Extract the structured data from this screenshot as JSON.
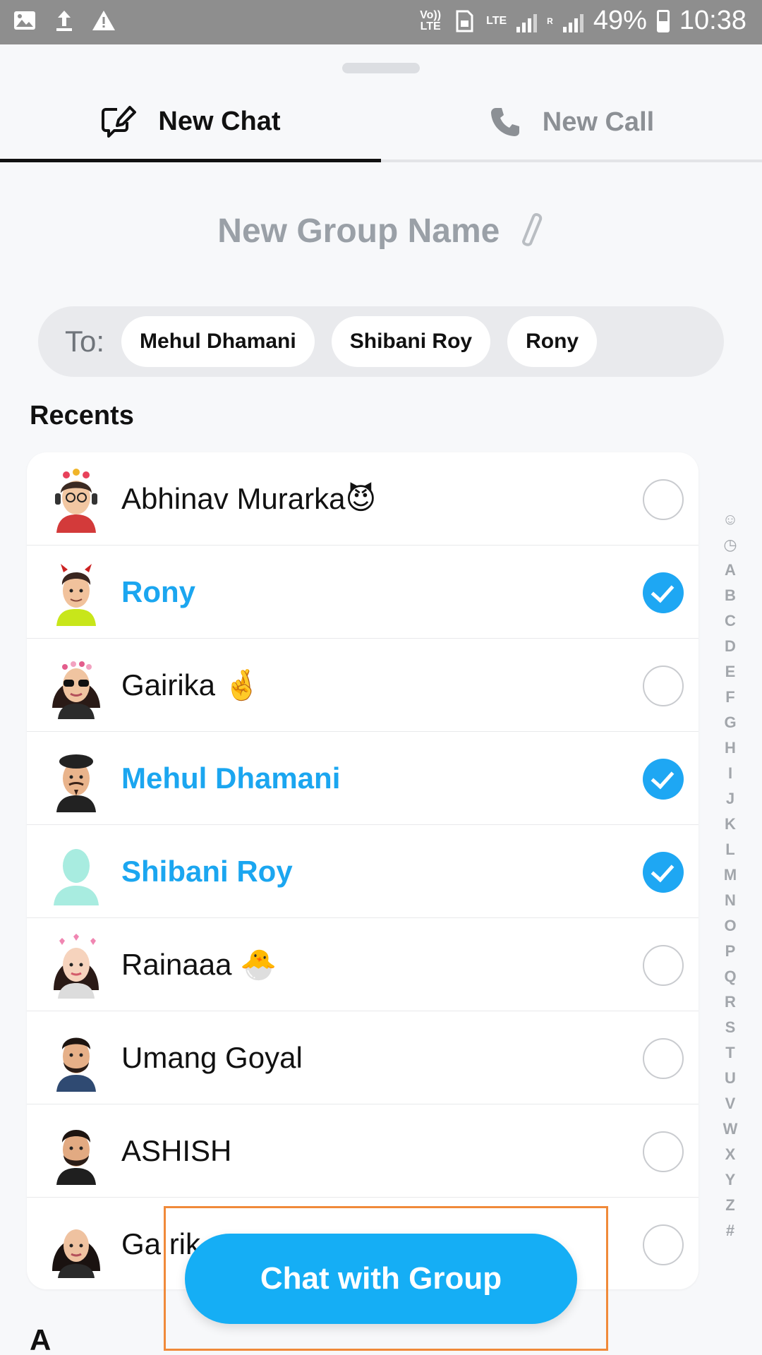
{
  "status_bar": {
    "battery": "49%",
    "time": "10:38",
    "volte_label": "Vo)) LTE",
    "lte_label": "LTE",
    "roaming_label": "R"
  },
  "tabs": [
    {
      "label": "New Chat",
      "active": true,
      "icon": "new-chat-icon"
    },
    {
      "label": "New Call",
      "active": false,
      "icon": "phone-icon"
    }
  ],
  "group_name_placeholder": "New Group Name",
  "to_bar": {
    "label": "To:",
    "chips": [
      "Mehul Dhamani",
      "Shibani Roy",
      "Rony"
    ]
  },
  "recents_title": "Recents",
  "contacts": [
    {
      "name": "Abhinav Murarka😈",
      "selected": false
    },
    {
      "name": "Rony",
      "selected": true
    },
    {
      "name": "Gairika 🤞",
      "selected": false
    },
    {
      "name": "Mehul Dhamani",
      "selected": true
    },
    {
      "name": "Shibani Roy",
      "selected": true
    },
    {
      "name": "Rainaaa 🐣",
      "selected": false
    },
    {
      "name": "Umang Goyal",
      "selected": false
    },
    {
      "name": "ASHISH",
      "selected": false
    },
    {
      "name": "Ga rik",
      "selected": false
    }
  ],
  "alphabet_index": [
    "☺",
    "◷",
    "A",
    "B",
    "C",
    "D",
    "E",
    "F",
    "G",
    "H",
    "I",
    "J",
    "K",
    "L",
    "M",
    "N",
    "O",
    "P",
    "Q",
    "R",
    "S",
    "T",
    "U",
    "V",
    "W",
    "X",
    "Y",
    "Z",
    "#"
  ],
  "section_letter": "A",
  "cta_label": "Chat with Group",
  "colors": {
    "accent": "#1ea7f3",
    "selected_text": "#1ba6f0",
    "highlight_box": "#f08a3a"
  }
}
